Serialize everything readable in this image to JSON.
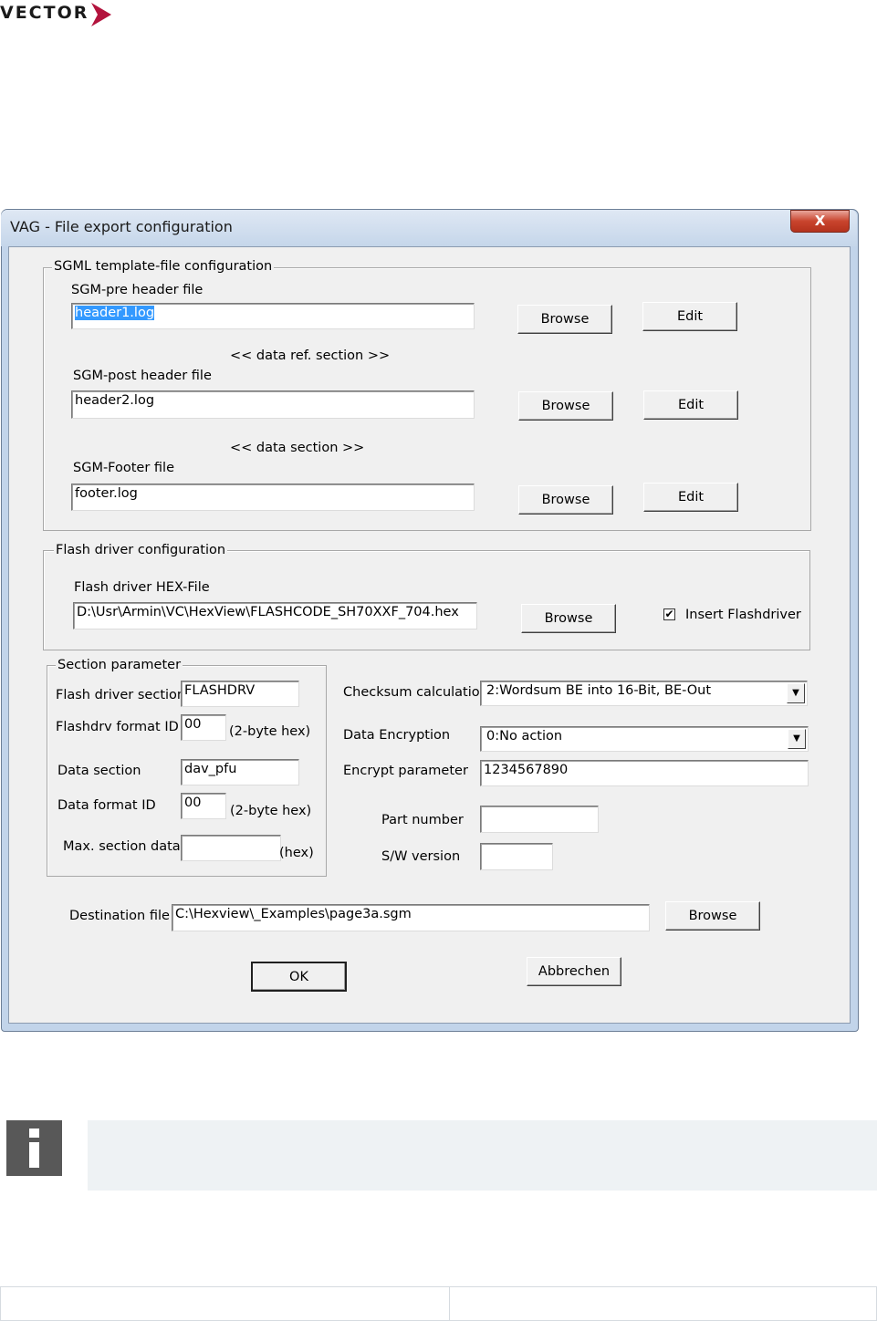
{
  "logo": {
    "text": "VECTOR",
    "brand_color": "#b3133d"
  },
  "window": {
    "title": "VAG - File export configuration",
    "close_label": "X",
    "titlebar_color": "#c2d4ea"
  },
  "sgml_group": {
    "legend": "SGML template-file configuration",
    "pre_header": {
      "label": "SGM-pre header file",
      "value": "header1.log",
      "browse": "Browse",
      "edit": "Edit"
    },
    "data_ref_section": "<<  data ref. section >>",
    "post_header": {
      "label": "SGM-post header file",
      "value": "header2.log",
      "browse": "Browse",
      "edit": "Edit"
    },
    "data_section": "<< data section >>",
    "footer": {
      "label": "SGM-Footer file",
      "value": "footer.log",
      "browse": "Browse",
      "edit": "Edit"
    }
  },
  "flash_group": {
    "legend": "Flash driver configuration",
    "hex_label": "Flash driver HEX-File",
    "hex_value": "D:\\Usr\\Armin\\VC\\HexView\\FLASHCODE_SH70XXF_704.hex",
    "browse": "Browse",
    "insert_checkbox": {
      "label": "Insert Flashdriver",
      "checked": true,
      "mark": "✔"
    }
  },
  "section_group": {
    "legend": "Section parameter",
    "flash_driver_section": {
      "label": "Flash driver section",
      "value": "FLASHDRV"
    },
    "flashdrv_format_id": {
      "label": "Flashdrv format ID",
      "value": "00",
      "suffix": "(2-byte hex)"
    },
    "data_section": {
      "label": "Data section",
      "value": "dav_pfu"
    },
    "data_format_id": {
      "label": "Data format ID",
      "value": "00",
      "suffix": "(2-byte hex)"
    },
    "max_section_data": {
      "label": "Max. section data",
      "value": "",
      "suffix": "(hex)"
    }
  },
  "right_params": {
    "checksum": {
      "label": "Checksum calculation",
      "value": "2:Wordsum BE into 16-Bit, BE-Out"
    },
    "encryption": {
      "label": "Data Encryption",
      "value": "0:No action"
    },
    "encrypt_param": {
      "label": "Encrypt parameter",
      "value": "1234567890"
    },
    "part_number": {
      "label": "Part number",
      "value": ""
    },
    "sw_version": {
      "label": "S/W version",
      "value": ""
    }
  },
  "destination": {
    "label": "Destination file",
    "value": "C:\\Hexview\\_Examples\\page3a.sgm",
    "browse": "Browse"
  },
  "buttons": {
    "ok": "OK",
    "cancel": "Abbrechen"
  },
  "info": {
    "icon_glyph": "i",
    "icon": "info-icon"
  }
}
